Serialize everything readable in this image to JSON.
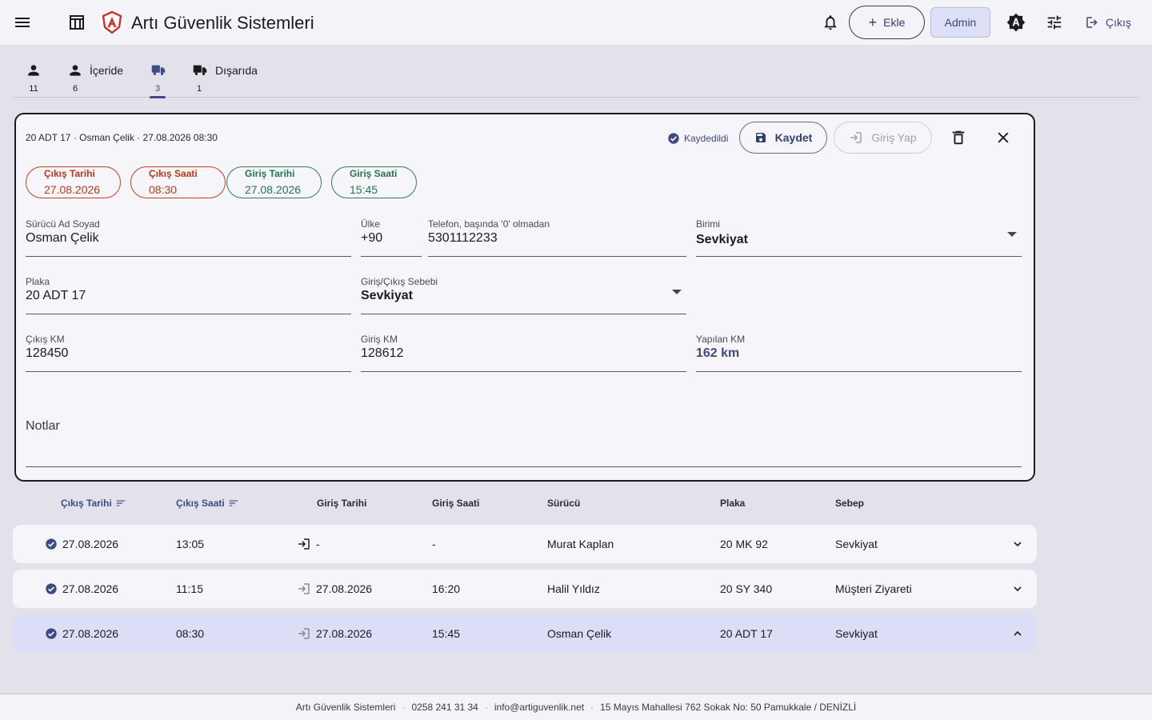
{
  "app": {
    "title": "Artı Güvenlik Sistemleri"
  },
  "header": {
    "add_label": "Ekle",
    "admin_label": "Admin",
    "logout_label": "Çıkış"
  },
  "tabs": [
    {
      "label": "",
      "count": "11",
      "icon": "person-icon"
    },
    {
      "label": "İçeride",
      "count": "6",
      "icon": "person-icon"
    },
    {
      "label": "",
      "count": "3",
      "icon": "truck-icon",
      "active": true
    },
    {
      "label": "Dışarıda",
      "count": "1",
      "icon": "truck-icon"
    }
  ],
  "record": {
    "summary": "20 ADT 17 · Osman Çelik · 27.08.2026 08:30",
    "saved_label": "Kaydedildi",
    "save_label": "Kaydet",
    "checkin_label": "Giriş Yap",
    "chips": {
      "exit_date": {
        "title": "Çıkış Tarihi",
        "value": "27.08.2026"
      },
      "exit_time": {
        "title": "Çıkış Saati",
        "value": "08:30"
      },
      "entry_date": {
        "title": "Giriş Tarihi",
        "value": "27.08.2026"
      },
      "entry_time": {
        "title": "Giriş Saati",
        "value": "15:45"
      }
    },
    "fields": {
      "driver": {
        "label": "Sürücü Ad Soyad",
        "value": "Osman Çelik"
      },
      "country": {
        "label": "Ülke",
        "value": "+90"
      },
      "phone": {
        "label": "Telefon, başında '0' olmadan",
        "value": "5301112233"
      },
      "unit": {
        "label": "Birimi",
        "value": "Sevkiyat"
      },
      "plate": {
        "label": "Plaka",
        "value": "20 ADT 17"
      },
      "reason": {
        "label": "Giriş/Çıkış Sebebi",
        "value": "Sevkiyat"
      },
      "exit_km": {
        "label": "Çıkış KM",
        "value": "128450"
      },
      "entry_km": {
        "label": "Giriş KM",
        "value": "128612"
      },
      "total_km": {
        "label": "Yapılan KM",
        "value": "162 km"
      },
      "notes": {
        "label": "Notlar"
      }
    }
  },
  "table": {
    "headers": {
      "exit_date": "Çıkış Tarihi",
      "exit_time": "Çıkış Saati",
      "entry_date": "Giriş Tarihi",
      "entry_time": "Giriş Saati",
      "driver": "Sürücü",
      "plate": "Plaka",
      "reason": "Sebep"
    },
    "rows": [
      {
        "exit_date": "27.08.2026",
        "exit_time": "13:05",
        "entry_date": "-",
        "entry_time": "-",
        "driver": "Murat Kaplan",
        "plate": "20 MK 92",
        "reason": "Sevkiyat"
      },
      {
        "exit_date": "27.08.2026",
        "exit_time": "11:15",
        "entry_date": "27.08.2026",
        "entry_time": "16:20",
        "driver": "Halil Yıldız",
        "plate": "20 SY 340",
        "reason": "Müşteri Ziyareti"
      },
      {
        "exit_date": "27.08.2026",
        "exit_time": "08:30",
        "entry_date": "27.08.2026",
        "entry_time": "15:45",
        "driver": "Osman Çelik",
        "plate": "20 ADT 17",
        "reason": "Sevkiyat"
      }
    ]
  },
  "footer": {
    "company": "Artı Güvenlik Sistemleri",
    "phone": "0258 241 31 34",
    "email": "info@artiguvenlik.net",
    "address": "15 Mayıs Mahallesi 762 Sokak No: 50 Pamukkale / DENİZLİ"
  },
  "colors": {
    "accent": "#3d4a86",
    "exit": "#b53a1a",
    "entry": "#23744f",
    "selected_row": "#dcddf6"
  }
}
